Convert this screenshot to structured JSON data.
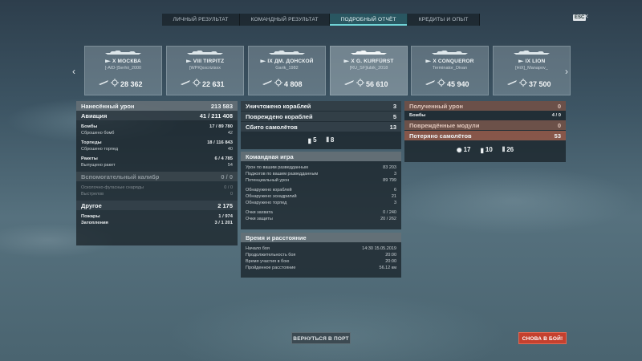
{
  "tabs": [
    "ЛИЧНЫЙ РЕЗУЛЬТАТ",
    "КОМАНДНЫЙ РЕЗУЛЬТАТ",
    "ПОДРОБНЫЙ ОТЧЁТ",
    "КРЕДИТЫ И ОПЫТ"
  ],
  "active_tab": 2,
  "esc_label": "ESC",
  "ships": [
    {
      "name": "X МОСКВА",
      "player": "[-AID-]Serhii_2000",
      "damage": "28 362"
    },
    {
      "name": "VIII TIRPITZ",
      "player": "[WPK]xxcrizisxx",
      "damage": "22 631"
    },
    {
      "name": "IX ДМ. ДОНСКОЙ",
      "player": "Garik_1982",
      "damage": "4 808"
    },
    {
      "name": "X G. KURFÜRST",
      "player": "[RU_SF]lubik_2018",
      "damage": "56 610"
    },
    {
      "name": "X CONQUEROR",
      "player": "Terminator_Divan",
      "damage": "45 940"
    },
    {
      "name": "IX LION",
      "player": "[HiX]_Manapov_",
      "damage": "37 500"
    }
  ],
  "dealt": {
    "header": {
      "label": "Нанесённый урон",
      "value": "213 583"
    },
    "aviation": {
      "label": "Авиация",
      "value": "41 / 211 408"
    },
    "bombs": {
      "label": "Бомбы",
      "value": "17 / 89 780"
    },
    "bombs_dropped": {
      "label": "Сброшено бомб",
      "value": "42"
    },
    "torpedoes": {
      "label": "Торпеды",
      "value": "18 / 116 843"
    },
    "torpedoes_dropped": {
      "label": "Сброшено торпед",
      "value": "40"
    },
    "rockets": {
      "label": "Ракеты",
      "value": "6 / 4 785"
    },
    "rockets_fired": {
      "label": "Выпущено ракет",
      "value": "54"
    },
    "secondary": {
      "label": "Вспомогательный калибр",
      "value": "0 / 0"
    },
    "he_shells": {
      "label": "Осколочно-фугасные снаряды",
      "value": "0 / 0"
    },
    "shots": {
      "label": "Выстрелов",
      "value": "0"
    },
    "other": {
      "label": "Другое",
      "value": "2 175"
    },
    "fires": {
      "label": "Пожары",
      "value": "1 / 974"
    },
    "floods": {
      "label": "Затопления",
      "value": "3 / 1 201"
    }
  },
  "kills": {
    "destroyed": {
      "label": "Уничтожено кораблей",
      "value": "3"
    },
    "damaged": {
      "label": "Повреждено кораблей",
      "value": "5"
    },
    "planes": {
      "label": "Сбито самолётов",
      "value": "13"
    },
    "icon_counts": [
      "5",
      "8"
    ]
  },
  "team": {
    "header": "Командная игра",
    "rows": [
      {
        "label": "Урон по вашим разведданным",
        "value": "83 203"
      },
      {
        "label": "Поджогов по вашим разведданным",
        "value": "3"
      },
      {
        "label": "Потенциальный урон",
        "value": "89 799"
      },
      {
        "label": "Обнаружено кораблей",
        "value": "6"
      },
      {
        "label": "Обнаружено эскадрилий",
        "value": "21"
      },
      {
        "label": "Обнаружено торпед",
        "value": "3"
      },
      {
        "label": "Очки захвата",
        "value": "0 / 240"
      },
      {
        "label": "Очки защиты",
        "value": "20 / 262"
      }
    ]
  },
  "time": {
    "header": "Время и расстояние",
    "rows": [
      {
        "label": "Начало боя",
        "value": "14:30  15.05.2019"
      },
      {
        "label": "Продолжительность боя",
        "value": "20:00"
      },
      {
        "label": "Время участия в бою",
        "value": "20:00"
      },
      {
        "label": "Пройденное расстояние",
        "value": "56.12 км"
      }
    ]
  },
  "received": {
    "header": {
      "label": "Полученный урон",
      "value": "0"
    },
    "bombs": {
      "label": "Бомбы",
      "value": "4 / 0"
    },
    "modules": {
      "label": "Повреждённые модули",
      "value": "0"
    },
    "planes_lost": {
      "label": "Потеряно самолётов",
      "value": "53"
    },
    "icon_counts": [
      "17",
      "10",
      "26"
    ]
  },
  "buttons": {
    "port": "ВЕРНУТЬСЯ В ПОРТ",
    "battle": "СНОВА В БОЙ!"
  }
}
